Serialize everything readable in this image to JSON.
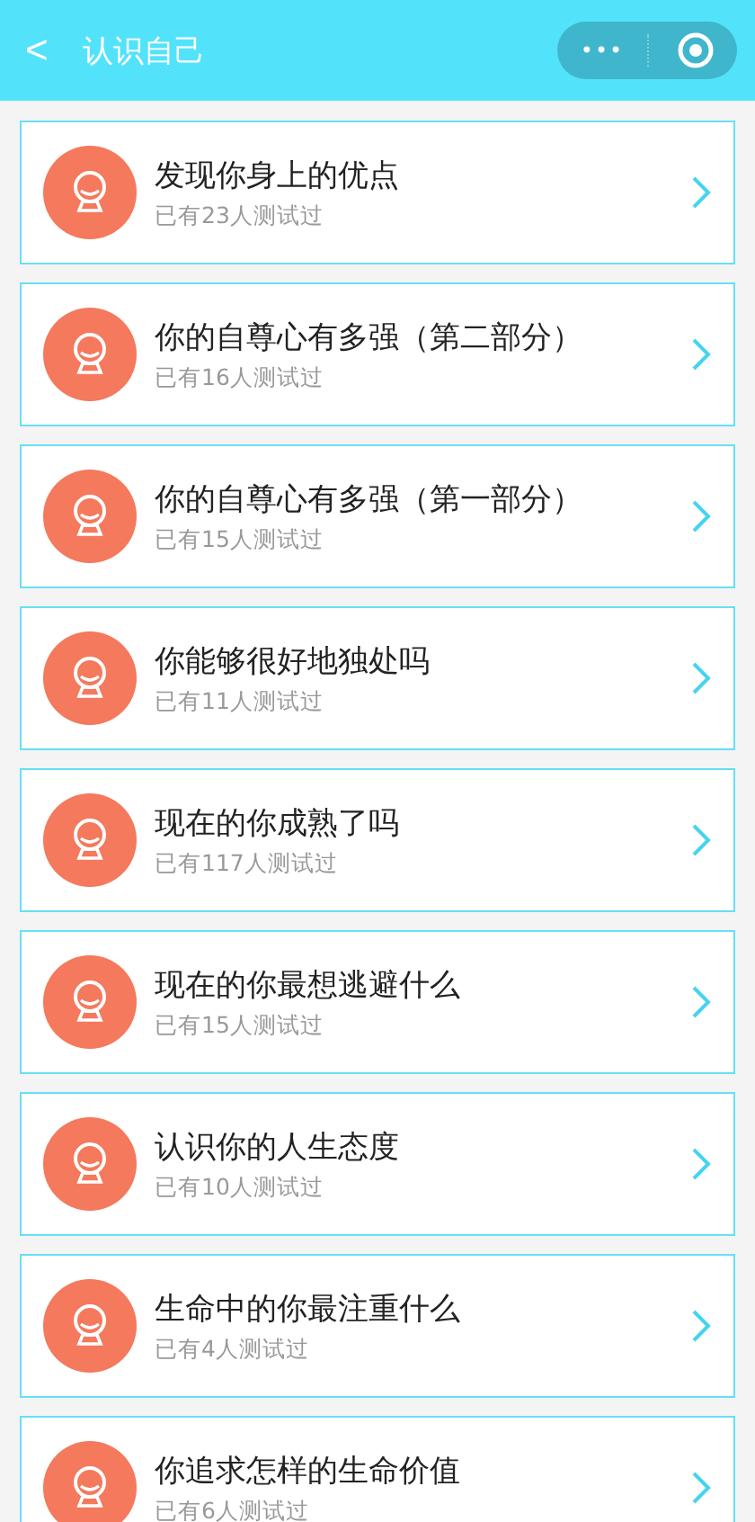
{
  "header": {
    "back": "<",
    "title": "认识自己",
    "menu": "•••"
  },
  "items": [
    {
      "title": "发现你身上的优点",
      "subtitle": "已有23人测试过"
    },
    {
      "title": "你的自尊心有多强（第二部分）",
      "subtitle": "已有16人测试过"
    },
    {
      "title": "你的自尊心有多强（第一部分）",
      "subtitle": "已有15人测试过"
    },
    {
      "title": "你能够很好地独处吗",
      "subtitle": "已有11人测试过"
    },
    {
      "title": "现在的你成熟了吗",
      "subtitle": "已有117人测试过"
    },
    {
      "title": "现在的你最想逃避什么",
      "subtitle": "已有15人测试过"
    },
    {
      "title": "认识你的人生态度",
      "subtitle": "已有10人测试过"
    },
    {
      "title": "生命中的你最注重什么",
      "subtitle": "已有4人测试过"
    },
    {
      "title": "你追求怎样的生命价值",
      "subtitle": "已有6人测试过"
    }
  ]
}
